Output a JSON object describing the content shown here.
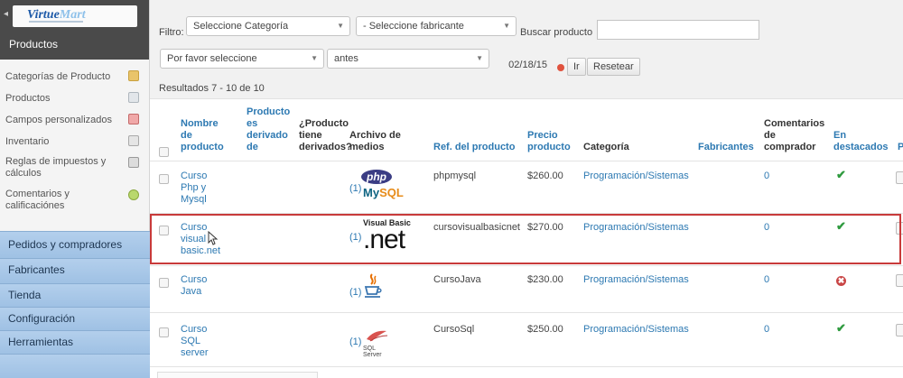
{
  "sidebar": {
    "logo_text_a": "Virtue",
    "logo_text_b": "Mart",
    "section_title": "Productos",
    "items": [
      {
        "label": "Categorías de Producto",
        "icon": "folder-icon"
      },
      {
        "label": "Productos",
        "icon": "page-icon"
      },
      {
        "label": "Campos personalizados",
        "icon": "puzzle-icon"
      },
      {
        "label": "Inventario",
        "icon": "grid-icon"
      },
      {
        "label": "Reglas de impuestos y cálculos",
        "icon": "calculator-icon"
      },
      {
        "label": "Comentarios y calificaciónes",
        "icon": "comment-icon"
      }
    ],
    "nav": [
      "Pedidos y compradores",
      "Fabricantes",
      "Tienda",
      "Configuración",
      "Herramientas"
    ]
  },
  "filters": {
    "label": "Filtro:",
    "category": "Seleccione Categoría",
    "manufacturer": "- Seleccione fabricante",
    "search_label": "Buscar producto",
    "search_value": "",
    "select_option": "Por favor seleccione",
    "when": "antes",
    "date": "02/18/15",
    "go": "Ir",
    "reset": "Resetear"
  },
  "results_text": "Resultados 7 - 10 de 10",
  "columns": {
    "name": [
      "Nombre",
      "de",
      "producto"
    ],
    "derived_from": [
      "Producto",
      "es",
      "derivado",
      "de"
    ],
    "has_derived": [
      "¿Producto",
      "tiene",
      "derivados?"
    ],
    "media": [
      "Archivo de",
      "medios"
    ],
    "sku": "Ref. del producto",
    "price": [
      "Precio",
      "producto"
    ],
    "category": "Categoría",
    "manufacturers": "Fabricantes",
    "reviews": [
      "Comentarios",
      "de",
      "comprador"
    ],
    "featured": [
      "En",
      "destacados"
    ],
    "cut": "P"
  },
  "rows": [
    {
      "name": [
        "Curso",
        "Php y",
        "Mysql"
      ],
      "media_count": "(1)",
      "sku": "phpmysql",
      "price": "$260.00",
      "category": "Programación/Sistemas",
      "reviews": "0",
      "featured": "✔",
      "logo_a": "php",
      "logo_b1": "My",
      "logo_b2": "SQL"
    },
    {
      "name": [
        "Curso",
        "visual",
        "basic.net"
      ],
      "media_count": "(1)",
      "sku": "cursovisualbasicnet",
      "price": "$270.00",
      "category": "Programación/Sistemas",
      "reviews": "0",
      "featured": "✔",
      "logo_a": "Visual Basic",
      "logo_b": ".net"
    },
    {
      "name": [
        "Curso",
        "Java"
      ],
      "media_count": "(1)",
      "sku": "CursoJava",
      "price": "$230.00",
      "category": "Programación/Sistemas",
      "reviews": "0",
      "featured": "✖"
    },
    {
      "name": [
        "Curso",
        "SQL",
        "server"
      ],
      "media_count": "(1)",
      "sku": "CursoSql",
      "price": "$250.00",
      "category": "Programación/Sistemas",
      "reviews": "0",
      "featured": "✔",
      "logo_a": "SQL Server"
    }
  ]
}
